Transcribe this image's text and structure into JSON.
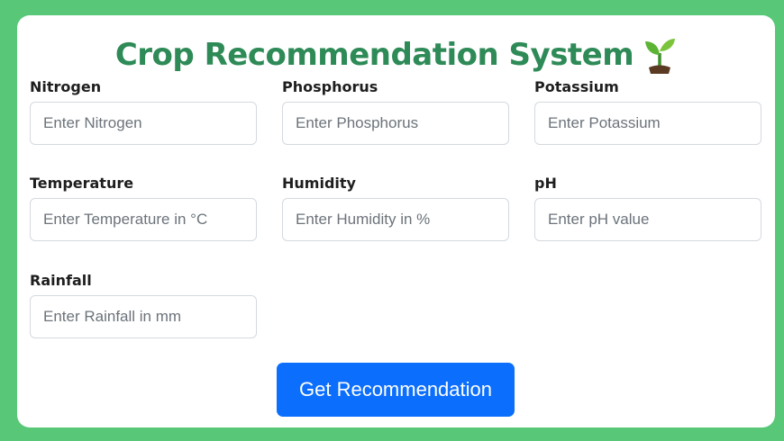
{
  "title": "Crop Recommendation System",
  "title_icon": "seedling-icon",
  "fields": [
    {
      "label": "Nitrogen",
      "placeholder": "Enter Nitrogen",
      "value": ""
    },
    {
      "label": "Phosphorus",
      "placeholder": "Enter Phosphorus",
      "value": ""
    },
    {
      "label": "Potassium",
      "placeholder": "Enter Potassium",
      "value": ""
    },
    {
      "label": "Temperature",
      "placeholder": "Enter Temperature in °C",
      "value": ""
    },
    {
      "label": "Humidity",
      "placeholder": "Enter Humidity in %",
      "value": ""
    },
    {
      "label": "pH",
      "placeholder": "Enter pH value",
      "value": ""
    },
    {
      "label": "Rainfall",
      "placeholder": "Enter Rainfall in mm",
      "value": ""
    }
  ],
  "submit_label": "Get Recommendation",
  "colors": {
    "background": "#58c878",
    "title": "#2e8a57",
    "button": "#0b6efd",
    "card": "#ffffff"
  }
}
